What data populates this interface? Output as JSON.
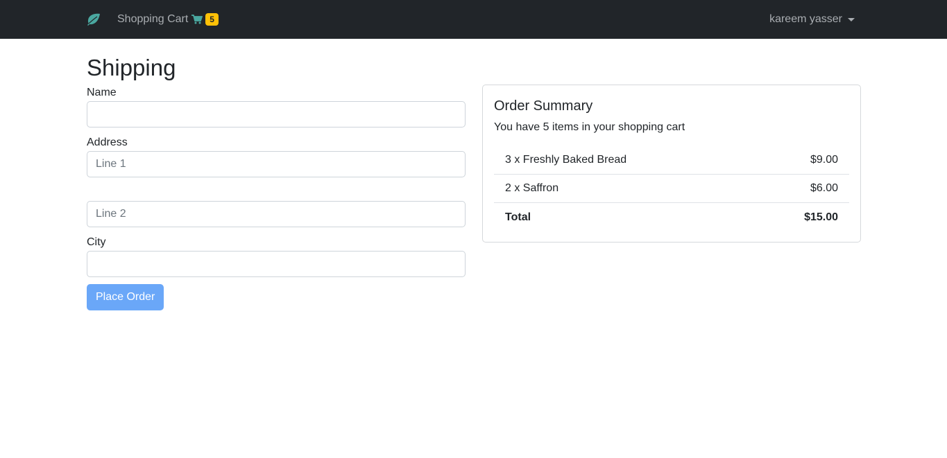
{
  "navbar": {
    "brand_icon": "leaf-icon",
    "brand_color": "#4aa8a0",
    "cart_label": "Shopping Cart",
    "cart_icon": "cart-icon",
    "cart_count": "5",
    "user_name": "kareem yasser"
  },
  "page": {
    "title": "Shipping"
  },
  "form": {
    "name_label": "Name",
    "name_value": "",
    "address_label": "Address",
    "line1_placeholder": "Line 1",
    "line2_placeholder": "Line 2",
    "city_label": "City",
    "city_value": "",
    "submit_label": "Place Order"
  },
  "summary": {
    "title": "Order Summary",
    "subtitle": "You have 5 items in your shopping cart",
    "items": [
      {
        "label": "3 x Freshly Baked Bread",
        "price": "$9.00"
      },
      {
        "label": "2 x Saffron",
        "price": "$6.00"
      }
    ],
    "total_label": "Total",
    "total_value": "$15.00"
  },
  "colors": {
    "navbar_bg": "#212529",
    "badge": "#ffc107",
    "primary_button": "#6aa7f8"
  }
}
